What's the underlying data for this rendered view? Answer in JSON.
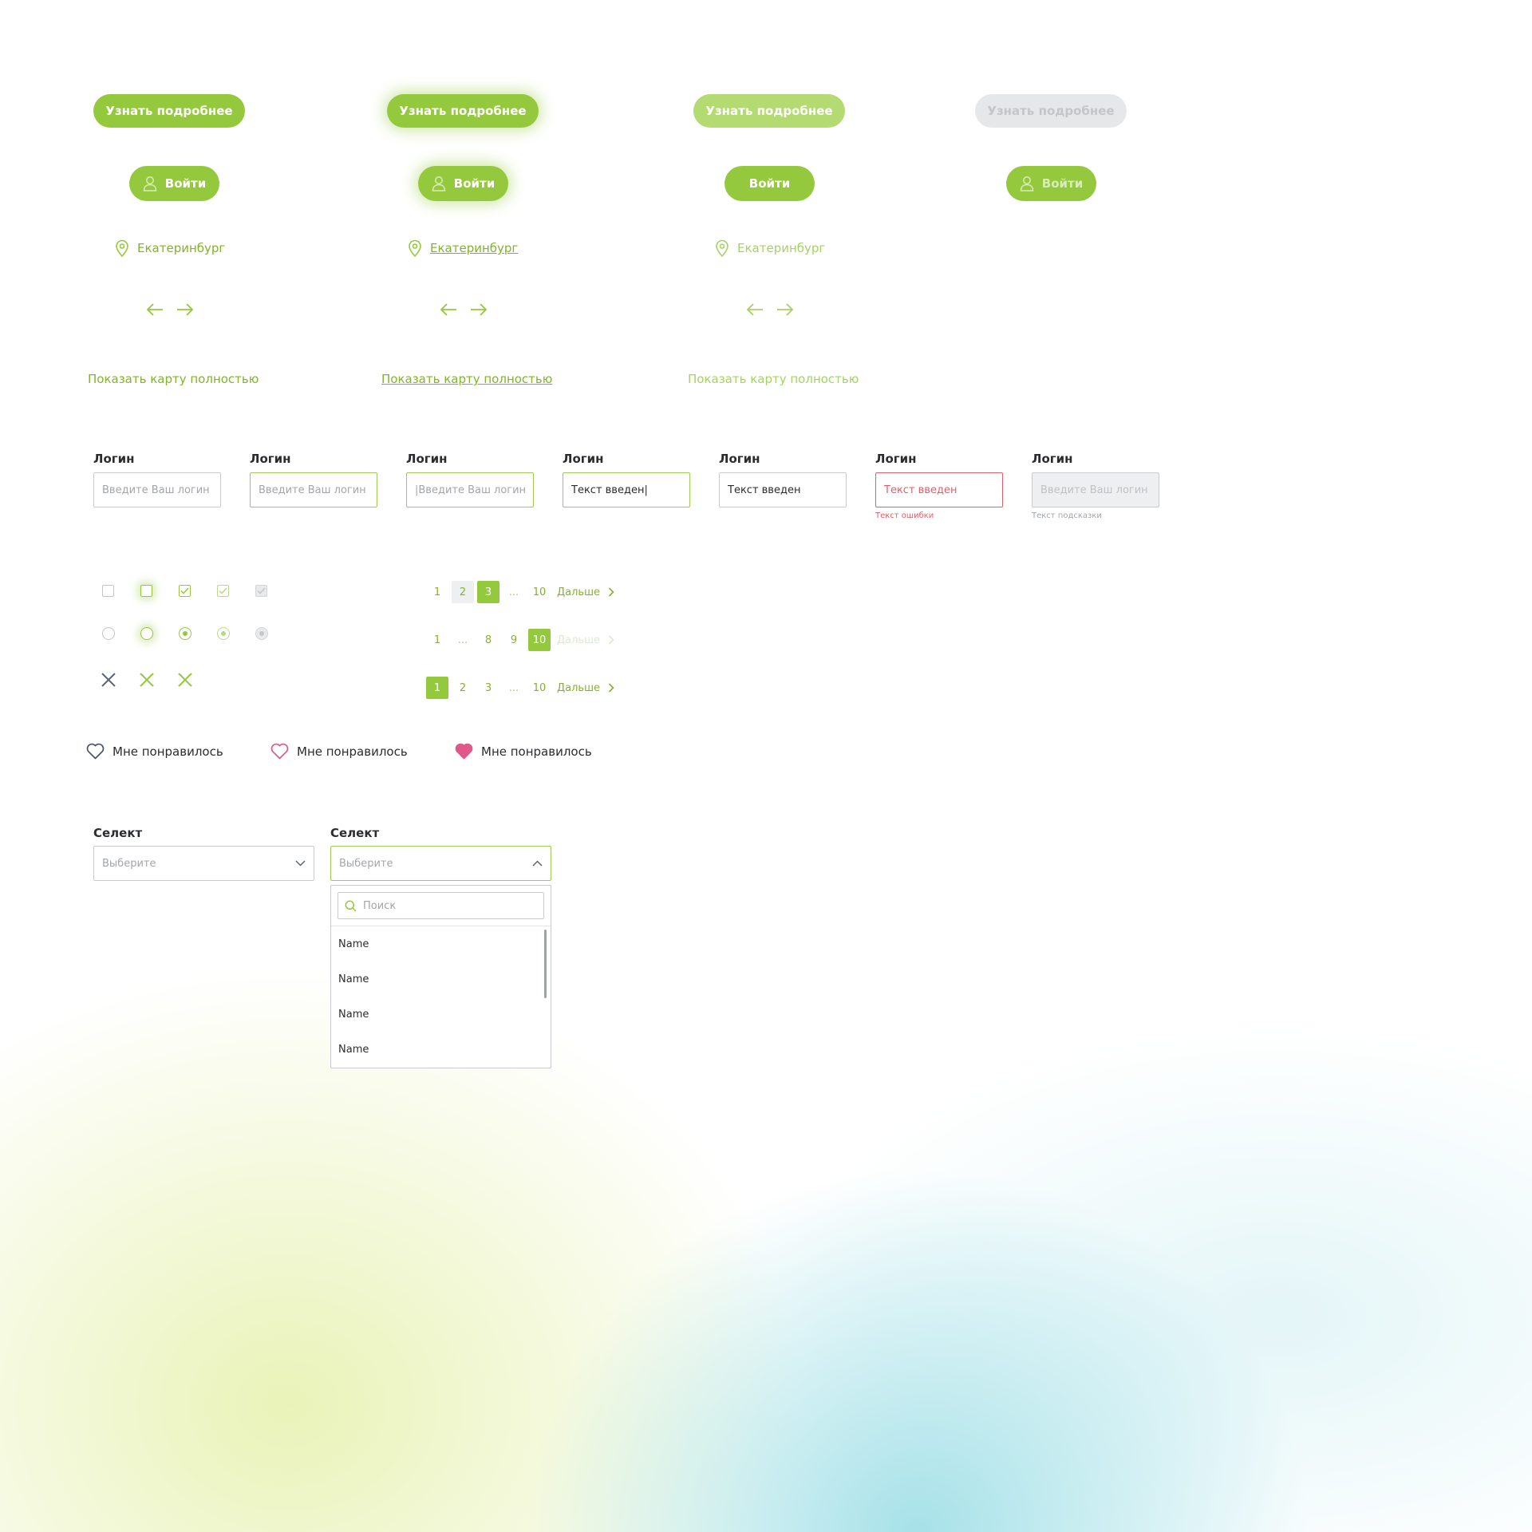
{
  "buttons": {
    "more_label": "Узнать подробнее",
    "login_label": "Войти"
  },
  "location": {
    "city": "Екатеринбург"
  },
  "map_link": "Показать карту полностью",
  "fields": {
    "label": "Логин",
    "placeholder": "Введите Ваш логин",
    "typing_value": "|Введите Ваш логин",
    "focused_value": "Текст введен|",
    "filled_value": "Текст введен",
    "error_value": "Текст введен",
    "error_text": "Текст ошибки",
    "hint_text": "Текст подсказки"
  },
  "pagination": {
    "row1": [
      "1",
      "2",
      "3",
      "...",
      "10"
    ],
    "row2": [
      "1",
      "...",
      "8",
      "9",
      "10"
    ],
    "row3": [
      "1",
      "2",
      "3",
      "...",
      "10"
    ],
    "next_label": "Дальше"
  },
  "like_label": "Мне понравилось",
  "select": {
    "label": "Селект",
    "placeholder": "Выберите",
    "search_placeholder": "Поиск",
    "options": [
      "Name",
      "Name",
      "Name",
      "Name"
    ]
  },
  "colors": {
    "accent": "#95c93d",
    "accent_light": "#b4da72",
    "error": "#e35d6a",
    "heart": "#e0578a"
  }
}
